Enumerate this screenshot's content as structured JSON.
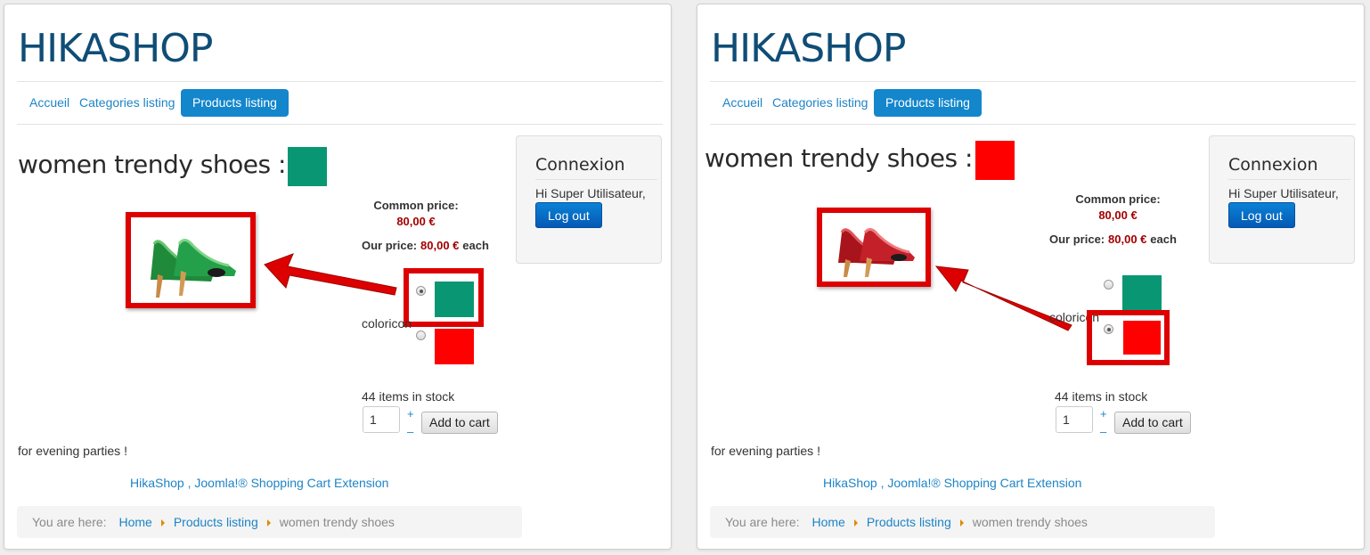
{
  "site_title": "HIKASHOP",
  "nav": {
    "home": "Accueil",
    "categories": "Categories listing",
    "products": "Products listing"
  },
  "product": {
    "title": "women trendy shoes :",
    "common_price_label": "Common price:",
    "common_price": "80,00 €",
    "our_price_label": "Our price:",
    "our_price": "80,00 €",
    "each": "each",
    "characteristic_label": "coloricon",
    "stock": "44 items in stock",
    "quantity": "1",
    "qty_plus": "+",
    "qty_minus": "–",
    "add_to_cart": "Add to cart",
    "description": "for evening parties !"
  },
  "login": {
    "title": "Connexion",
    "greeting": "Hi Super Utilisateur,",
    "logout": "Log out"
  },
  "footer": {
    "link": "HikaShop , Joomla!® Shopping Cart Extension"
  },
  "breadcrumb": {
    "prefix": "You are here:",
    "home": "Home",
    "products": "Products listing",
    "current": "women trendy shoes"
  },
  "colors": {
    "green": "#099773",
    "red": "#ff0000",
    "highlight": "#dd0000",
    "title_blue": "#0f4d76",
    "link_blue": "#1d84c6",
    "price_red": "#a30000"
  },
  "panels": [
    {
      "selected_color": "green",
      "selected_option": 1,
      "image_icon": "green-shoe-image"
    },
    {
      "selected_color": "red",
      "selected_option": 2,
      "image_icon": "red-shoe-image"
    }
  ]
}
